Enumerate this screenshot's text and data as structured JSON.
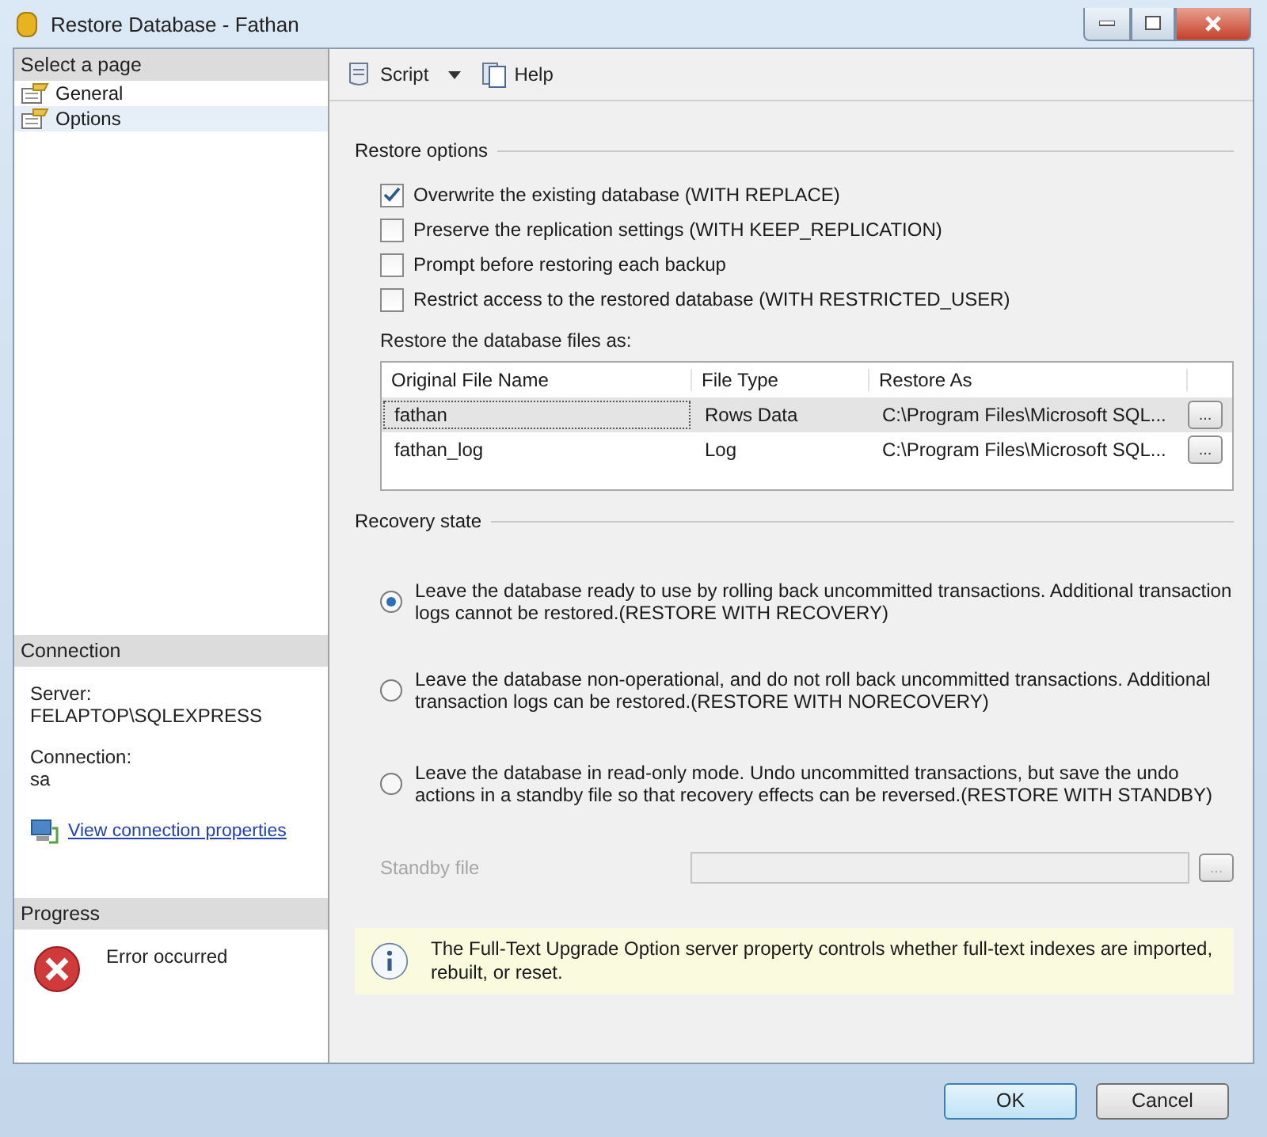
{
  "window": {
    "title": "Restore Database - Fathan"
  },
  "sidebar": {
    "header": "Select a page",
    "items": [
      {
        "label": "General",
        "selected": false
      },
      {
        "label": "Options",
        "selected": true
      }
    ]
  },
  "connection": {
    "header": "Connection",
    "server_label": "Server:",
    "server": "FELAPTOP\\SQLEXPRESS",
    "connection_label": "Connection:",
    "connection": "sa",
    "link": "View connection properties"
  },
  "progress": {
    "header": "Progress",
    "status": "Error occurred"
  },
  "toolbar": {
    "script": "Script",
    "help": "Help"
  },
  "restore_options": {
    "title": "Restore options",
    "options": [
      {
        "label": "Overwrite the existing database (WITH REPLACE)",
        "checked": true
      },
      {
        "label": "Preserve the replication settings (WITH KEEP_REPLICATION)",
        "checked": false
      },
      {
        "label": "Prompt before restoring each backup",
        "checked": false
      },
      {
        "label": "Restrict access to the restored database (WITH RESTRICTED_USER)",
        "checked": false
      }
    ]
  },
  "files": {
    "caption": "Restore the database files as:",
    "columns": [
      "Original File Name",
      "File Type",
      "Restore As"
    ],
    "rows": [
      {
        "name": "fathan",
        "type": "Rows Data",
        "restore_as": "C:\\Program Files\\Microsoft SQL...",
        "browse": "...",
        "selected": true
      },
      {
        "name": "fathan_log",
        "type": "Log",
        "restore_as": "C:\\Program Files\\Microsoft SQL...",
        "browse": "...",
        "selected": false
      }
    ]
  },
  "recovery": {
    "title": "Recovery state",
    "options": [
      {
        "label": "Leave the database ready to use by rolling back uncommitted transactions. Additional transaction logs cannot be restored.(RESTORE WITH RECOVERY)",
        "selected": true
      },
      {
        "label": "Leave the database non-operational, and do not roll back uncommitted transactions. Additional transaction logs can be restored.(RESTORE WITH NORECOVERY)",
        "selected": false
      },
      {
        "label": "Leave the database in read-only mode. Undo uncommitted transactions, but save the undo actions in a standby file so that recovery effects can be reversed.(RESTORE WITH STANDBY)",
        "selected": false
      }
    ]
  },
  "standby": {
    "label": "Standby file",
    "browse": "...",
    "disabled": true
  },
  "info": "The Full-Text Upgrade Option server property controls whether full-text indexes are imported, rebuilt, or reset.",
  "buttons": [
    {
      "label": "OK",
      "kind": "default"
    },
    {
      "label": "Cancel",
      "kind": "normal"
    }
  ]
}
